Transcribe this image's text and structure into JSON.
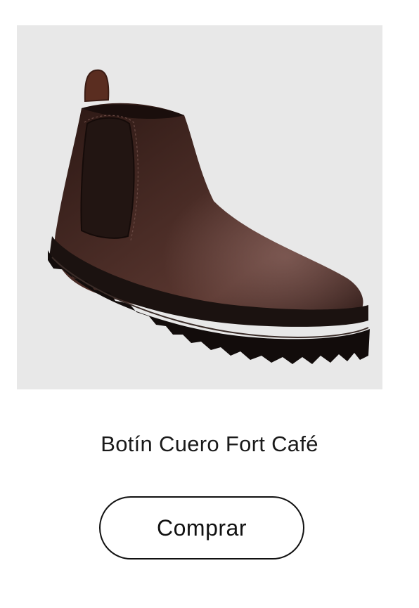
{
  "product": {
    "image_icon": "chelsea-boot-image",
    "image_background": "#e8e8e8",
    "boot_color": "#3a2420",
    "title": "Botín Cuero Fort Café"
  },
  "actions": {
    "buy_label": "Comprar"
  }
}
